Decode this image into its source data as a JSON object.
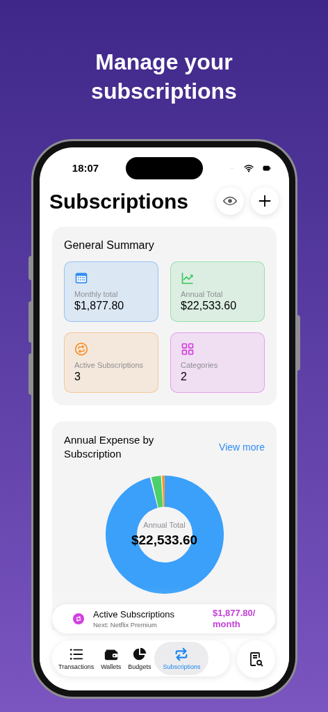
{
  "headline": "Manage your subscriptions",
  "status_bar": {
    "time": "18:07"
  },
  "header": {
    "title": "Subscriptions"
  },
  "summary": {
    "title": "General Summary",
    "tiles": [
      {
        "kind": "calendar",
        "label": "Monthly total",
        "value": "$1,877.80",
        "color": "#2f8cf2"
      },
      {
        "kind": "trend",
        "label": "Annual Total",
        "value": "$22,533.60",
        "color": "#34c759"
      },
      {
        "kind": "repeat",
        "label": "Active Subscriptions",
        "value": "3",
        "color": "#f7902a"
      },
      {
        "kind": "grid",
        "label": "Categories",
        "value": "2",
        "color": "#d33ee0"
      }
    ]
  },
  "chart_card": {
    "title": "Annual Expense by Subscription",
    "link": "View more",
    "center_label": "Annual Total",
    "center_value": "$22,533.60"
  },
  "active_banner": {
    "title": "Active Subscriptions",
    "subtitle": "Next: Netflix Premium",
    "amount": "$1,877.80/ month"
  },
  "tabs": [
    {
      "kind": "list",
      "label": "Transactions",
      "selected": false
    },
    {
      "kind": "wallet",
      "label": "Wallets",
      "selected": false
    },
    {
      "kind": "pie",
      "label": "Budgets",
      "selected": false
    },
    {
      "kind": "repeat",
      "label": "Subscriptions",
      "selected": true
    }
  ]
}
